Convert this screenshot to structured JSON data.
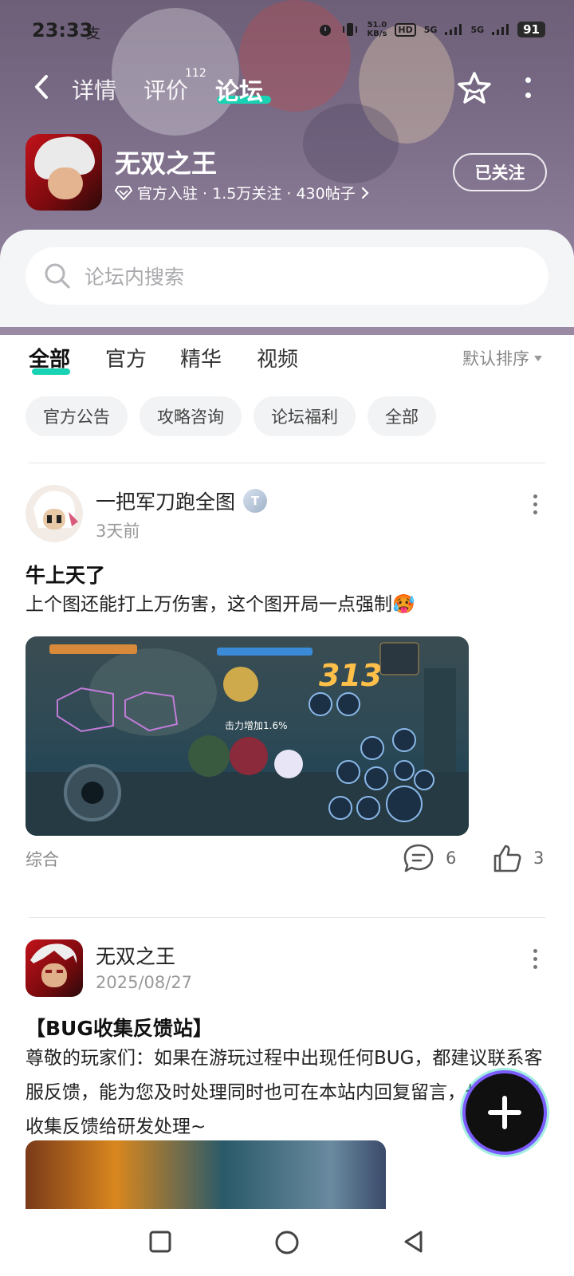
{
  "status_bar": {
    "time": "23:33",
    "alipay_glyph": "支",
    "net_speed_value": "51.0",
    "net_speed_unit": "KB/s",
    "hd": "HD",
    "sig1": "5G",
    "sig2": "5G",
    "battery": "91"
  },
  "nav": {
    "tabs": [
      {
        "label": "详情"
      },
      {
        "label": "评价",
        "badge": "112"
      },
      {
        "label": "论坛",
        "active": true
      }
    ]
  },
  "game": {
    "title": "无双之王",
    "meta": "官方入驻 · 1.5万关注 · 430帖子",
    "follow_label": "已关注"
  },
  "search": {
    "placeholder": "论坛内搜索"
  },
  "filters": {
    "tabs": [
      "全部",
      "官方",
      "精华",
      "视频"
    ],
    "sort_label": "默认排序",
    "chips": [
      "官方公告",
      "攻略咨询",
      "论坛福利",
      "全部"
    ]
  },
  "posts": [
    {
      "author": "一把军刀跑全图",
      "badge": "T",
      "time": "3天前",
      "title": "牛上天了",
      "body": "上个图还能打上万伤害，这个图开局一点强制🥵",
      "image_damage": "313",
      "image_buff": "击力增加1.6%",
      "tag": "综合",
      "comments": "6",
      "likes": "3"
    },
    {
      "author": "无双之王",
      "time": "2025/08/27",
      "title": "【BUG收集反馈站】",
      "body": "尊敬的玩家们：如果在游玩过程中出现任何BUG，都建议联系客服反馈，能为您及时处理同时也可在本站内回复留言，也将统统收集反馈给研发处理~"
    }
  ],
  "colors": {
    "accent": "#19d2b4",
    "hero_bg": "#7a6b86"
  },
  "icons": [
    "back-icon",
    "star-icon",
    "more-icon",
    "search-icon",
    "diamond-icon",
    "comment-icon",
    "like-icon",
    "plus-icon",
    "square-icon",
    "circle-icon",
    "triangle-back-icon"
  ]
}
